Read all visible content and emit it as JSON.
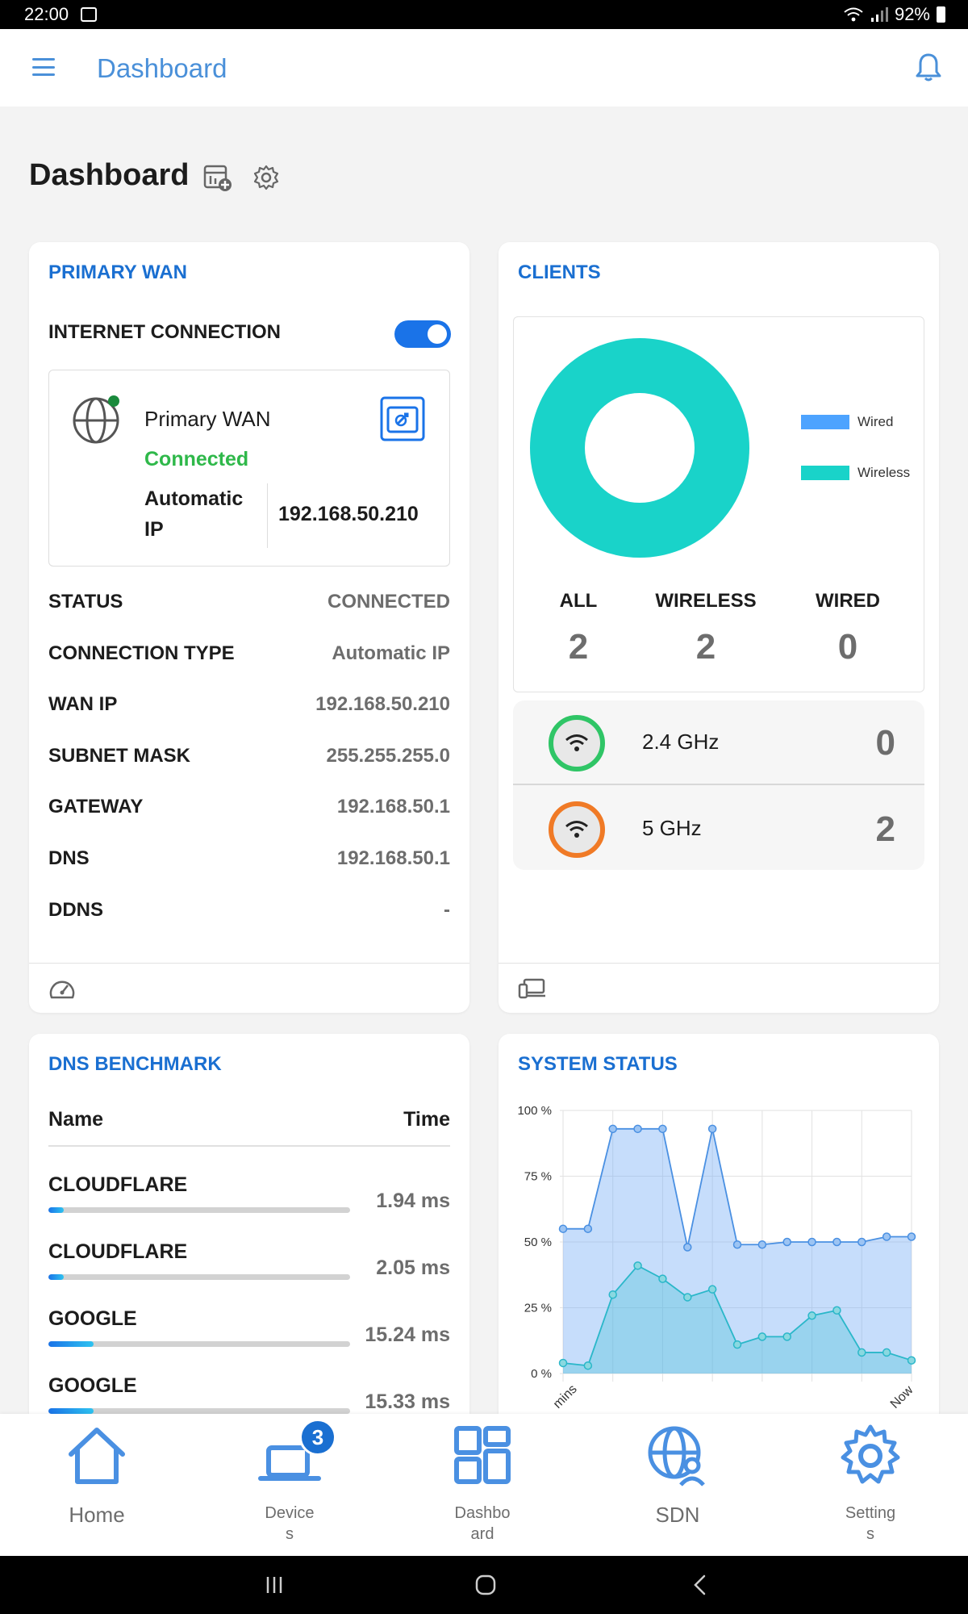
{
  "status_bar": {
    "time": "22:00",
    "battery": "92%"
  },
  "app_bar": {
    "title": "Dashboard"
  },
  "page": {
    "title": "Dashboard"
  },
  "primary_wan": {
    "title": "PRIMARY WAN",
    "internet_label": "INTERNET CONNECTION",
    "internet_on": true,
    "wan_name": "Primary WAN",
    "wan_status": "Connected",
    "wan_type": "Automatic IP",
    "wan_ip": "192.168.50.210",
    "rows": [
      {
        "label": "STATUS",
        "value": "CONNECTED"
      },
      {
        "label": "CONNECTION TYPE",
        "value": "Automatic IP"
      },
      {
        "label": "WAN IP",
        "value": "192.168.50.210"
      },
      {
        "label": "SUBNET MASK",
        "value": "255.255.255.0"
      },
      {
        "label": "GATEWAY",
        "value": "192.168.50.1"
      },
      {
        "label": "DNS",
        "value": "192.168.50.1"
      },
      {
        "label": "DDNS",
        "value": "-"
      }
    ]
  },
  "clients": {
    "title": "CLIENTS",
    "legend": [
      {
        "label": "Wired",
        "color": "#4da3ff"
      },
      {
        "label": "Wireless",
        "color": "#19d3c9"
      }
    ],
    "stats": [
      {
        "label": "ALL",
        "value": "2"
      },
      {
        "label": "WIRELESS",
        "value": "2"
      },
      {
        "label": "WIRED",
        "value": "0"
      }
    ],
    "bands": [
      {
        "label": "2.4 GHz",
        "count": "0",
        "color": "#2fc566"
      },
      {
        "label": "5 GHz",
        "count": "2",
        "color": "#f07a26"
      }
    ]
  },
  "dns_benchmark": {
    "title": "DNS BENCHMARK",
    "col_name": "Name",
    "col_time": "Time",
    "rows": [
      {
        "name": "CLOUDFLARE",
        "time": "1.94 ms",
        "fill_pct": 5
      },
      {
        "name": "CLOUDFLARE",
        "time": "2.05 ms",
        "fill_pct": 5
      },
      {
        "name": "GOOGLE",
        "time": "15.24 ms",
        "fill_pct": 15
      },
      {
        "name": "GOOGLE",
        "time": "15.33 ms",
        "fill_pct": 15
      }
    ]
  },
  "system_status": {
    "title": "SYSTEM STATUS",
    "x_start_label": "mins",
    "x_end_label": "Now"
  },
  "chart_data": {
    "type": "area",
    "ylim": [
      0,
      100
    ],
    "y_ticks": [
      "100 %",
      "75 %",
      "50 %",
      "25 %",
      "0 %"
    ],
    "x_labels": [
      "mins",
      "Now"
    ],
    "grid": true,
    "series": [
      {
        "color": "#4a90e2",
        "values": [
          55,
          55,
          93,
          93,
          93,
          48,
          93,
          49,
          49,
          50,
          50,
          50,
          50,
          52,
          52
        ]
      },
      {
        "color": "#2ab7c9",
        "values": [
          4,
          3,
          30,
          41,
          36,
          29,
          32,
          11,
          14,
          14,
          22,
          24,
          8,
          8,
          5
        ]
      }
    ]
  },
  "bottom_nav": [
    {
      "label": "Home",
      "icon": "home-icon"
    },
    {
      "label": "Device\ns",
      "icon": "devices-icon",
      "badge": "3"
    },
    {
      "label": "Dashbo\nard",
      "icon": "dashboard-icon"
    },
    {
      "label": "SDN",
      "icon": "sdn-icon"
    },
    {
      "label": "Setting\ns",
      "icon": "settings-icon"
    }
  ]
}
